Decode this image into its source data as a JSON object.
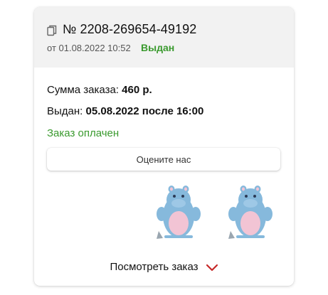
{
  "order": {
    "number": "№ 2208-269654-49192",
    "date": "от 01.08.2022 10:52",
    "status": "Выдан",
    "sum_label": "Сумма заказа:",
    "sum_value": "460 р.",
    "issued_label": "Выдан:",
    "issued_value": "05.08.2022 после 16:00",
    "payment_status": "Заказ оплачен",
    "rate_button": "Оцените нас",
    "view_order": "Посмотреть заказ"
  },
  "icons": {
    "copy": "copy-icon",
    "chevron": "chevron-down-icon"
  },
  "products": [
    "hippo-bath-mitt",
    "hippo-bath-mitt"
  ],
  "colors": {
    "status_green": "#3a9a2e",
    "chevron_red": "#c62828",
    "header_bg": "#f2f2f2",
    "hippo_blue": "#86b9dc",
    "hippo_pink": "#f2c4d4"
  }
}
